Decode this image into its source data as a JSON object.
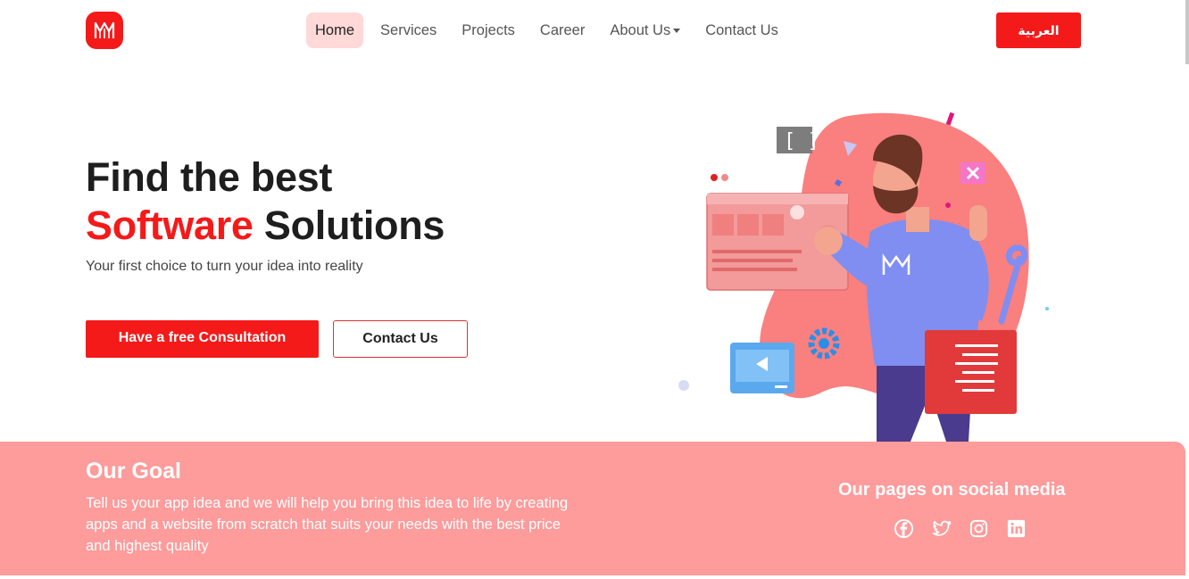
{
  "nav": {
    "items": [
      "Home",
      "Services",
      "Projects",
      "Career",
      "About Us",
      "Contact Us"
    ],
    "active": "Home",
    "language_button": "العربية"
  },
  "hero": {
    "title_line1": "Find the best",
    "title_highlight": "Software",
    "title_rest": "Solutions",
    "subtitle": "Your first choice to turn your idea into reality",
    "primary_button": "Have a free Consultation",
    "secondary_button": "Contact Us"
  },
  "goal": {
    "title": "Our Goal",
    "text": "Tell us your app idea and we will help you bring this idea to life by creating apps and a website from scratch that suits your needs with the best price and highest quality"
  },
  "social": {
    "title": "Our pages on social media",
    "icons": [
      "facebook-icon",
      "twitter-icon",
      "instagram-icon",
      "linkedin-icon"
    ]
  },
  "colors": {
    "brand": "#f41a1a",
    "active_nav_bg": "#ffd8d8",
    "goal_bg": "#fe9b9b"
  }
}
